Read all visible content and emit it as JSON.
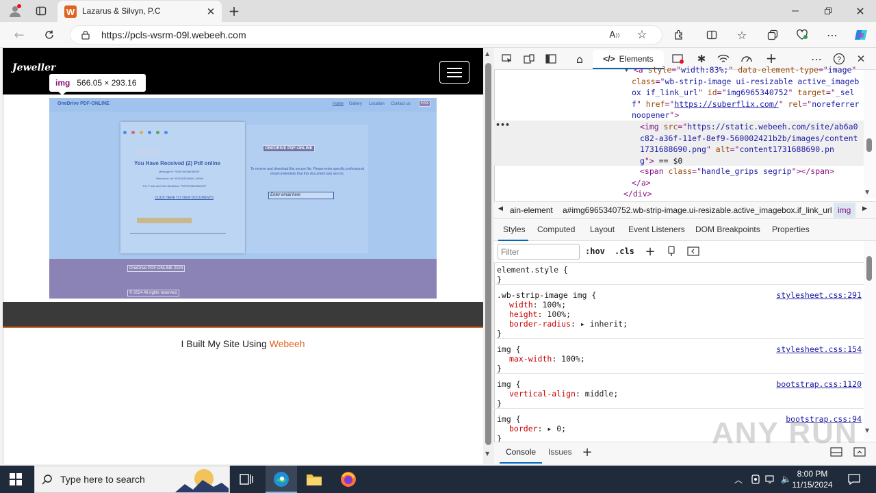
{
  "browser": {
    "tab_title": "Lazarus & Silvyn, P.C",
    "tab_favicon_letter": "W",
    "url": "https://pcls-wsrm-09l.webeeh.com"
  },
  "page": {
    "brand": "Jeweller",
    "tooltip": {
      "tag": "img",
      "size": "566.05 × 293.16"
    },
    "shot": {
      "nav_brand": "OneDrive PDF-ONLINE",
      "nav_items": [
        "Home",
        "Gallery",
        "Location",
        "Contact us",
        "FAX"
      ],
      "card_title": "You Have Received (2) Pdf online",
      "card_msg_id": "Message ID: *#4674#43#8*8458*",
      "card_ref": "Reference: ref 2023Z#403#4#0_0#98#",
      "card_sent": "The P was sent from Business \"PdfPDFABCBNSDR\"",
      "card_link": "CLICK HERE TO VIEW DOCUMENTS",
      "panel_badge": "ONEDRIVE PDF-ONLINE",
      "panel_text": "To receive and download this secure file. Please enter specific professional email credentials that this document was sent to.",
      "email_placeholder": "Enter email here",
      "footer_1": "OneDrive PDF-ONLINE 2024",
      "footer_2": "© 2024 All rights reserved."
    },
    "footer_prefix": "I Built My Site Using ",
    "footer_link": "Webeeh"
  },
  "devtools": {
    "active_tab": "Elements",
    "dom_lines": [
      {
        "indent": "▾",
        "parts": [
          [
            "tag",
            "<a "
          ],
          [
            "attr",
            "style"
          ],
          [
            "tag",
            "=\""
          ],
          [
            "val",
            "width:83%;"
          ],
          [
            "tag",
            "\" "
          ],
          [
            "attr",
            "data-element-type"
          ],
          [
            "tag",
            "=\""
          ],
          [
            "val",
            "image"
          ],
          [
            "tag",
            "\""
          ]
        ]
      },
      {
        "indent": "",
        "parts": [
          [
            "attr",
            "class"
          ],
          [
            "tag",
            "=\""
          ],
          [
            "val",
            "wb-strip-image ui-resizable active_imageb"
          ]
        ]
      },
      {
        "indent": "",
        "parts": [
          [
            "val",
            "ox if_link_url"
          ],
          [
            "tag",
            "\" "
          ],
          [
            "attr",
            "id"
          ],
          [
            "tag",
            "=\""
          ],
          [
            "val",
            "img6965340752"
          ],
          [
            "tag",
            "\" "
          ],
          [
            "attr",
            "target"
          ],
          [
            "tag",
            "=\""
          ],
          [
            "val",
            "_sel"
          ]
        ]
      },
      {
        "indent": "",
        "parts": [
          [
            "val",
            "f"
          ],
          [
            "tag",
            "\" "
          ],
          [
            "attr",
            "href"
          ],
          [
            "tag",
            "=\""
          ],
          [
            "lnk",
            "https://suberflix.com/"
          ],
          [
            "tag",
            "\" "
          ],
          [
            "attr",
            "rel"
          ],
          [
            "tag",
            "=\""
          ],
          [
            "val",
            "noreferrer"
          ]
        ]
      },
      {
        "indent": "",
        "parts": [
          [
            "val",
            "noopener"
          ],
          [
            "tag",
            "\">"
          ]
        ]
      }
    ],
    "selected_lines": [
      [
        [
          "tag",
          "<img "
        ],
        [
          "attr",
          "src"
        ],
        [
          "tag",
          "=\""
        ],
        [
          "val",
          "https://static.webeeh.com/site/ab6a0"
        ]
      ],
      [
        [
          "val",
          "c82-a36f-11ef-8ef9-560002421b2b/images/content"
        ]
      ],
      [
        [
          "val",
          "1731688690.png"
        ],
        [
          "tag",
          "\" "
        ],
        [
          "attr",
          "alt"
        ],
        [
          "tag",
          "=\""
        ],
        [
          "val",
          "content1731688690.pn"
        ]
      ],
      [
        [
          "val",
          "g"
        ],
        [
          "tag",
          "\">"
        ],
        [
          "plain",
          " == $0"
        ]
      ]
    ],
    "after_lines": [
      [
        [
          "tag",
          "<span "
        ],
        [
          "attr",
          "class"
        ],
        [
          "tag",
          "=\""
        ],
        [
          "val",
          "handle_grips segrip"
        ],
        [
          "tag",
          "\"></span>"
        ]
      ],
      [
        [
          "tag",
          "</a>"
        ]
      ],
      [
        [
          "tag",
          "</div>"
        ]
      ]
    ],
    "breadcrumbs": [
      "ain-element",
      "a#img6965340752.wb-strip-image.ui-resizable.active_imagebox.if_link_url",
      "img"
    ],
    "subtabs": [
      "Styles",
      "Computed",
      "Layout",
      "Event Listeners",
      "DOM Breakpoints",
      "Properties"
    ],
    "filter_placeholder": "Filter",
    "filter_buttons": [
      ":hov",
      ".cls"
    ],
    "rules": [
      {
        "selector": "element.style {",
        "source": "",
        "decls": []
      },
      {
        "selector": ".wb-strip-image img {",
        "source": "stylesheet.css:291",
        "decls": [
          [
            "width",
            "100%;"
          ],
          [
            "height",
            "100%;"
          ],
          [
            "border-radius",
            "▸ inherit;"
          ]
        ]
      },
      {
        "selector": "img {",
        "source": "stylesheet.css:154",
        "decls": [
          [
            "max-width",
            "100%;"
          ]
        ]
      },
      {
        "selector": "img {",
        "source": "bootstrap.css:1120",
        "decls": [
          [
            "vertical-align",
            "middle;"
          ]
        ]
      },
      {
        "selector": "img {",
        "source": "bootstrap.css:94",
        "decls": [
          [
            "border",
            "▸ 0;"
          ]
        ]
      }
    ],
    "drawer_tabs": [
      "Console",
      "Issues"
    ]
  },
  "taskbar": {
    "search_placeholder": "Type here to search",
    "time": "8:00 PM",
    "date": "11/15/2024"
  },
  "watermark": "ANY RUN"
}
